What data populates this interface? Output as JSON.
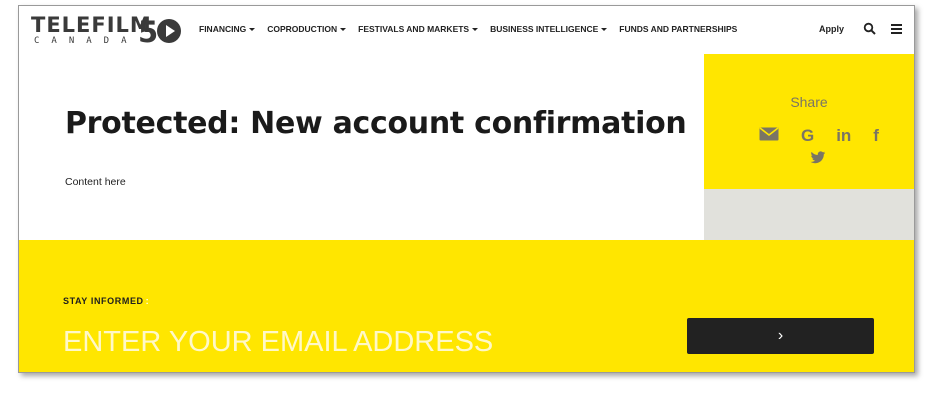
{
  "header": {
    "logo_word": "TELEFILM",
    "logo_sub": "CANADA",
    "logo_number": "5",
    "nav": [
      {
        "label": "FINANCING",
        "dropdown": true
      },
      {
        "label": "COPRODUCTION",
        "dropdown": true
      },
      {
        "label": "FESTIVALS AND MARKETS",
        "dropdown": true
      },
      {
        "label": "BUSINESS INTELLIGENCE",
        "dropdown": true
      },
      {
        "label": "FUNDS AND PARTNERSHIPS",
        "dropdown": false
      }
    ],
    "apply_label": "Apply",
    "search_icon": "search-icon",
    "menu_icon": "hamburger-menu-icon"
  },
  "main": {
    "title": "Protected: New account confirmation",
    "content": "Content here"
  },
  "share": {
    "label": "Share",
    "icons": [
      "email-icon",
      "google-icon",
      "linkedin-icon",
      "facebook-icon",
      "twitter-icon"
    ],
    "google_glyph": "G",
    "linkedin_glyph": "in",
    "facebook_glyph": "f"
  },
  "newsletter": {
    "label": "STAY INFORMED",
    "label_suffix": ":",
    "email_placeholder": "ENTER YOUR EMAIL ADDRESS",
    "submit_glyph": "›"
  },
  "colors": {
    "brand_yellow": "#ffe600",
    "share_text": "#7a7564",
    "dark_button": "#222222",
    "gray_panel": "#e1e1dc"
  }
}
